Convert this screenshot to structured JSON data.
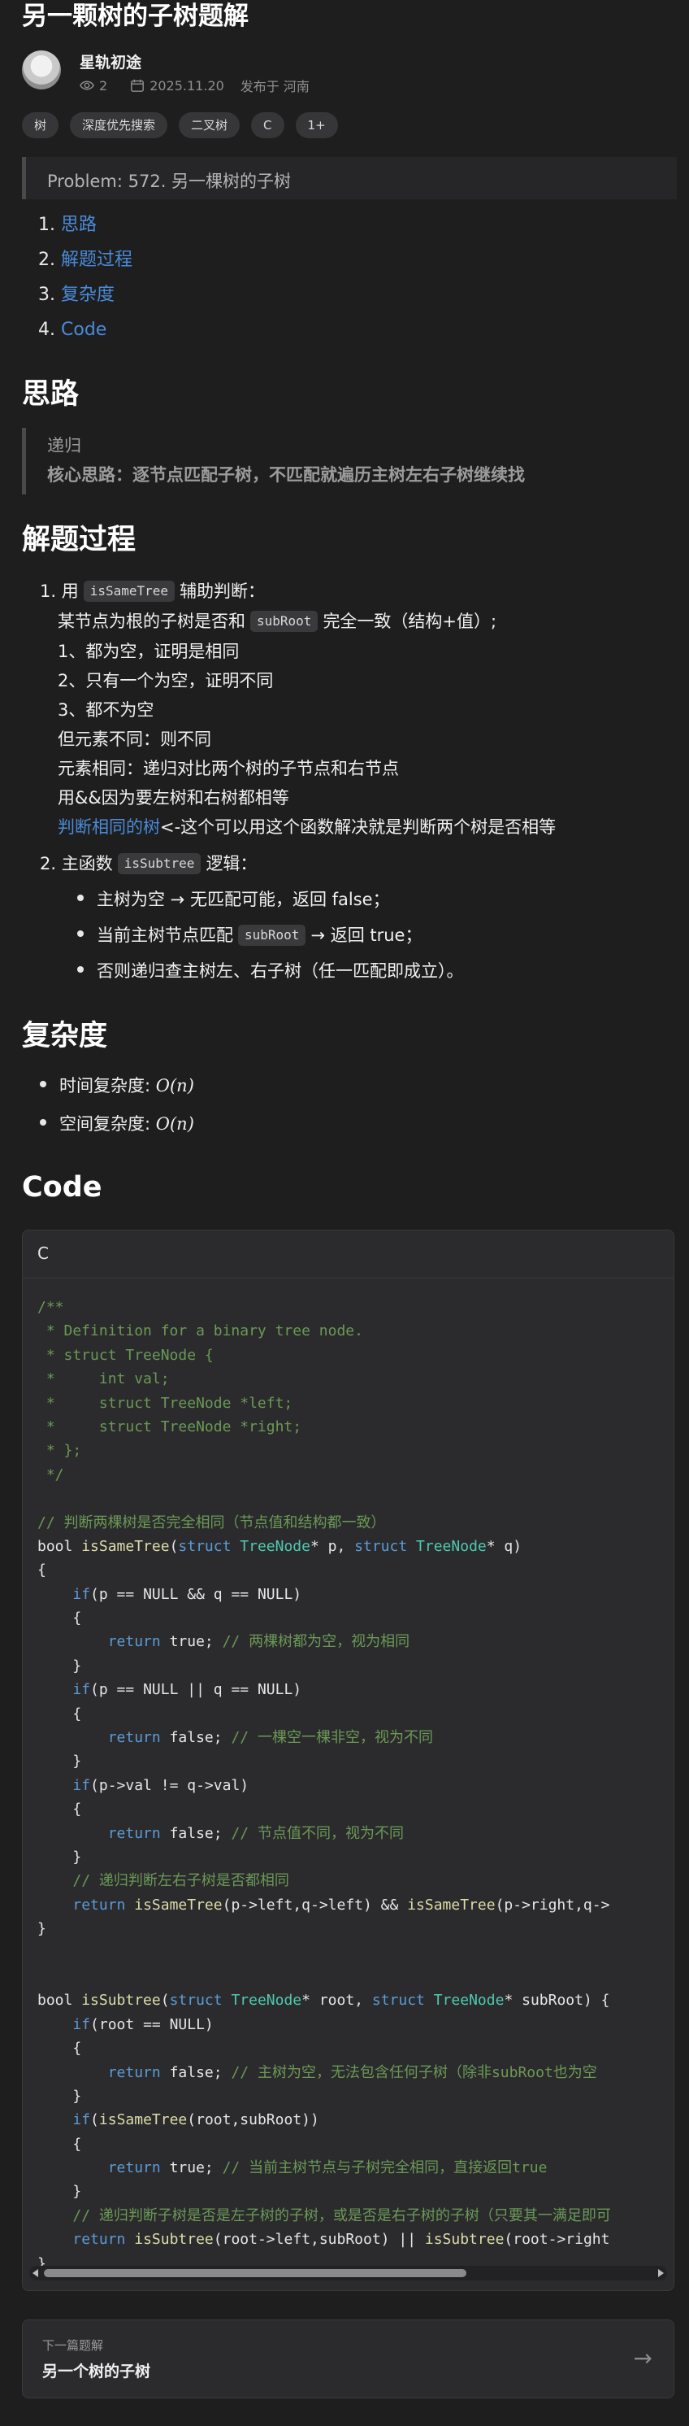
{
  "post": {
    "title": "另一颗树的子树题解",
    "author": "星轨初途",
    "views": "2",
    "date": "2025.11.20",
    "location": "发布于 河南",
    "tags": [
      "树",
      "深度优先搜索",
      "二叉树",
      "C",
      "1+"
    ]
  },
  "problem": "Problem: 572. 另一棵树的子树",
  "toc": [
    {
      "num": "1.",
      "label": "思路"
    },
    {
      "num": "2.",
      "label": "解题过程"
    },
    {
      "num": "3.",
      "label": "复杂度"
    },
    {
      "num": "4.",
      "label": "Code"
    }
  ],
  "sections": {
    "idea": {
      "heading": "思路",
      "quote1": "递归",
      "quote2": "核心思路：逐节点匹配子树，不匹配就遍历主树左右子树继续找"
    },
    "process": {
      "heading": "解题过程",
      "item1_num": "1.",
      "item1_pre": "用",
      "item1_code": "isSameTree",
      "item1_post": "辅助判断：",
      "line2_pre": "某节点为根的子树是否和",
      "line2_code": "subRoot",
      "line2_post": "完全一致（结构+值）;",
      "line3": "1、都为空，证明是相同",
      "line4": "2、只有一个为空，证明不同",
      "line5": "3、都不为空",
      "line6": "但元素不同：则不同",
      "line7": "元素相同：递归对比两个树的子节点和右节点",
      "line8": "用&&因为要左树和右树都相等",
      "line9_link": "判断相同的树",
      "line9_post": "<-这个可以用这个函数解决就是判断两个树是否相等",
      "item2_num": "2.",
      "item2_pre": "主函数",
      "item2_code": "isSubtree",
      "item2_post": "逻辑：",
      "b1": "主树为空 → 无匹配可能，返回 false；",
      "b2_pre": "当前主树节点匹配",
      "b2_code": "subRoot",
      "b2_post": "→ 返回 true；",
      "b3": "否则递归查主树左、右子树（任一匹配即成立）。"
    },
    "complexity": {
      "heading": "复杂度",
      "time_label": "时间复杂度:",
      "space_label": "空间复杂度:",
      "value": "O(n)"
    },
    "code": {
      "heading": "Code",
      "lang": "C"
    }
  },
  "code_lines": [
    [
      [
        "cm",
        "/**"
      ]
    ],
    [
      [
        "cm",
        " * Definition for a binary tree node."
      ]
    ],
    [
      [
        "cm",
        " * struct TreeNode {"
      ]
    ],
    [
      [
        "cm",
        " *     int val;"
      ]
    ],
    [
      [
        "cm",
        " *     struct TreeNode *left;"
      ]
    ],
    [
      [
        "cm",
        " *     struct TreeNode *right;"
      ]
    ],
    [
      [
        "cm",
        " * };"
      ]
    ],
    [
      [
        "cm",
        " */"
      ]
    ],
    [
      [
        "",
        ""
      ]
    ],
    [
      [
        "cm",
        "// 判断两棵树是否完全相同（节点值和结构都一致）"
      ]
    ],
    [
      [
        "",
        "bool "
      ],
      [
        "fn",
        "isSameTree"
      ],
      [
        "",
        "("
      ],
      [
        "kw",
        "struct"
      ],
      [
        "",
        " "
      ],
      [
        "ty",
        "TreeNode"
      ],
      [
        "",
        "* p, "
      ],
      [
        "kw",
        "struct"
      ],
      [
        "",
        " "
      ],
      [
        "ty",
        "TreeNode"
      ],
      [
        "",
        "* q)"
      ]
    ],
    [
      [
        "",
        "{"
      ]
    ],
    [
      [
        "",
        "    "
      ],
      [
        "kw",
        "if"
      ],
      [
        "",
        "(p == NULL && q == NULL)"
      ]
    ],
    [
      [
        "",
        "    {"
      ]
    ],
    [
      [
        "",
        "        "
      ],
      [
        "kw",
        "return"
      ],
      [
        "",
        " true; "
      ],
      [
        "cm",
        "// 两棵树都为空，视为相同"
      ]
    ],
    [
      [
        "",
        "    }"
      ]
    ],
    [
      [
        "",
        "    "
      ],
      [
        "kw",
        "if"
      ],
      [
        "",
        "(p == NULL || q == NULL)"
      ]
    ],
    [
      [
        "",
        "    {"
      ]
    ],
    [
      [
        "",
        "        "
      ],
      [
        "kw",
        "return"
      ],
      [
        "",
        " false; "
      ],
      [
        "cm",
        "// 一棵空一棵非空，视为不同"
      ]
    ],
    [
      [
        "",
        "    }"
      ]
    ],
    [
      [
        "",
        "    "
      ],
      [
        "kw",
        "if"
      ],
      [
        "",
        "(p->val != q->val)"
      ]
    ],
    [
      [
        "",
        "    {"
      ]
    ],
    [
      [
        "",
        "        "
      ],
      [
        "kw",
        "return"
      ],
      [
        "",
        " false; "
      ],
      [
        "cm",
        "// 节点值不同，视为不同"
      ]
    ],
    [
      [
        "",
        "    }"
      ]
    ],
    [
      [
        "",
        "    "
      ],
      [
        "cm",
        "// 递归判断左右子树是否都相同"
      ]
    ],
    [
      [
        "",
        "    "
      ],
      [
        "kw",
        "return"
      ],
      [
        "",
        " "
      ],
      [
        "fn",
        "isSameTree"
      ],
      [
        "",
        "(p->left,q->left) && "
      ],
      [
        "fn",
        "isSameTree"
      ],
      [
        "",
        "(p->right,q->"
      ]
    ],
    [
      [
        "",
        "}"
      ]
    ],
    [
      [
        "",
        ""
      ]
    ],
    [
      [
        "",
        ""
      ]
    ],
    [
      [
        "",
        "bool "
      ],
      [
        "fn",
        "isSubtree"
      ],
      [
        "",
        "("
      ],
      [
        "kw",
        "struct"
      ],
      [
        "",
        " "
      ],
      [
        "ty",
        "TreeNode"
      ],
      [
        "",
        "* root, "
      ],
      [
        "kw",
        "struct"
      ],
      [
        "",
        " "
      ],
      [
        "ty",
        "TreeNode"
      ],
      [
        "",
        "* subRoot) {"
      ]
    ],
    [
      [
        "",
        "    "
      ],
      [
        "kw",
        "if"
      ],
      [
        "",
        "(root == NULL)"
      ]
    ],
    [
      [
        "",
        "    {"
      ]
    ],
    [
      [
        "",
        "        "
      ],
      [
        "kw",
        "return"
      ],
      [
        "",
        " false; "
      ],
      [
        "cm",
        "// 主树为空，无法包含任何子树（除非subRoot也为空"
      ]
    ],
    [
      [
        "",
        "    }"
      ]
    ],
    [
      [
        "",
        "    "
      ],
      [
        "kw",
        "if"
      ],
      [
        "",
        "("
      ],
      [
        "fn",
        "isSameTree"
      ],
      [
        "",
        "(root,subRoot))"
      ]
    ],
    [
      [
        "",
        "    {"
      ]
    ],
    [
      [
        "",
        "        "
      ],
      [
        "kw",
        "return"
      ],
      [
        "",
        " true; "
      ],
      [
        "cm",
        "// 当前主树节点与子树完全相同，直接返回true"
      ]
    ],
    [
      [
        "",
        "    }"
      ]
    ],
    [
      [
        "",
        "    "
      ],
      [
        "cm",
        "// 递归判断子树是否是左子树的子树，或是否是右子树的子树（只要其一满足即可"
      ]
    ],
    [
      [
        "",
        "    "
      ],
      [
        "kw",
        "return"
      ],
      [
        "",
        " "
      ],
      [
        "fn",
        "isSubtree"
      ],
      [
        "",
        "(root->left,subRoot) || "
      ],
      [
        "fn",
        "isSubtree"
      ],
      [
        "",
        "(root->right"
      ]
    ],
    [
      [
        "",
        "}"
      ]
    ]
  ],
  "next": {
    "label": "下一篇题解",
    "title": "另一个树的子树"
  }
}
